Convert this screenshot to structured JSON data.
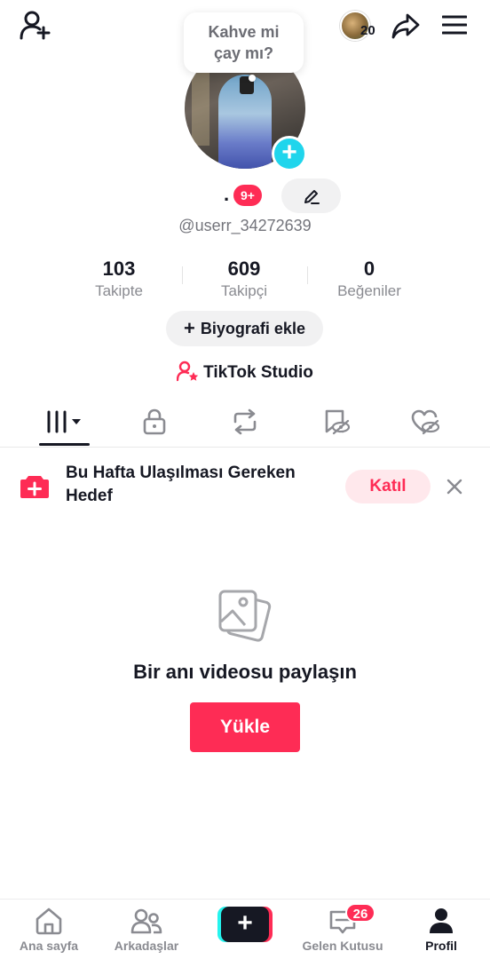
{
  "header": {
    "story_count": "20"
  },
  "bubble": {
    "line1": "Kahve mi",
    "line2": "çay mı?"
  },
  "profile": {
    "display_name": ".",
    "notif_badge": "9+",
    "username": "@userr_34272639"
  },
  "stats": [
    {
      "value": "103",
      "label": "Takipte"
    },
    {
      "value": "609",
      "label": "Takipçi"
    },
    {
      "value": "0",
      "label": "Beğeniler"
    }
  ],
  "bio_button": {
    "plus": "+",
    "label": "Biyografi ekle"
  },
  "studio": {
    "label": "TikTok Studio"
  },
  "tabs": [
    {
      "icon": "grid-icon",
      "active": true
    },
    {
      "icon": "lock-icon"
    },
    {
      "icon": "repost-icon"
    },
    {
      "icon": "bookmark-hidden-icon"
    },
    {
      "icon": "heart-hidden-icon"
    }
  ],
  "goal_banner": {
    "text": "Bu Hafta Ulaşılması Gereken Hedef",
    "join_label": "Katıl"
  },
  "empty_state": {
    "title": "Bir anı videosu paylaşın",
    "upload_label": "Yükle"
  },
  "bottom_nav": {
    "home": "Ana sayfa",
    "friends": "Arkadaşlar",
    "create": "+",
    "inbox": "Gelen Kutusu",
    "inbox_badge": "26",
    "profile": "Profil"
  },
  "colors": {
    "accent": "#fe2c55",
    "cyan": "#20d5ec",
    "text": "#161823",
    "muted": "#8a8b91"
  }
}
